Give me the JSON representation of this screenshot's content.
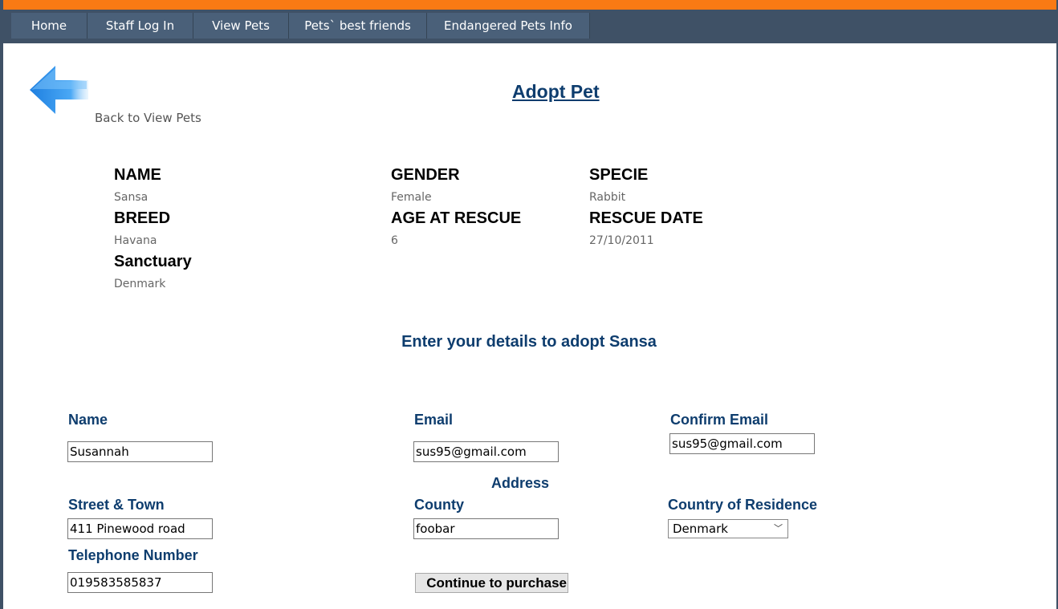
{
  "nav": [
    "Home",
    "Staff Log In",
    "View Pets",
    "Pets` best friends",
    "Endangered Pets Info"
  ],
  "back": {
    "label": "Back to View Pets",
    "icon": "back-arrow-icon"
  },
  "page_title": "Adopt Pet",
  "pet_info": {
    "name_label": "NAME",
    "name": "Sansa",
    "gender_label": "GENDER",
    "gender": "Female",
    "specie_label": "SPECIE",
    "specie": "Rabbit",
    "breed_label": "BREED",
    "breed": "Havana",
    "age_label": "AGE AT RESCUE",
    "age": "6",
    "rescue_date_label": "RESCUE DATE",
    "rescue_date": "27/10/2011",
    "sanctuary_label": "Sanctuary",
    "sanctuary": "Denmark"
  },
  "form": {
    "intro": "Enter your details to adopt Sansa",
    "name_label": "Name",
    "name_value": "Susannah",
    "email_label": "Email",
    "email_value": "sus95@gmail.com",
    "confirm_email_label": "Confirm Email",
    "confirm_email_value": "sus95@gmail.com",
    "address_heading": "Address",
    "street_label": "Street & Town",
    "street_value": "411 Pinewood road",
    "county_label": "County",
    "county_value": "foobar",
    "country_label": "Country of Residence",
    "country_value": "Denmark",
    "phone_label": "Telephone Number",
    "phone_value": "019583585837",
    "submit_label": "Continue to purchase"
  },
  "colors": {
    "accent_bar": "#f97a14",
    "nav_bg": "#3f5166",
    "heading": "#0e3d6e"
  }
}
